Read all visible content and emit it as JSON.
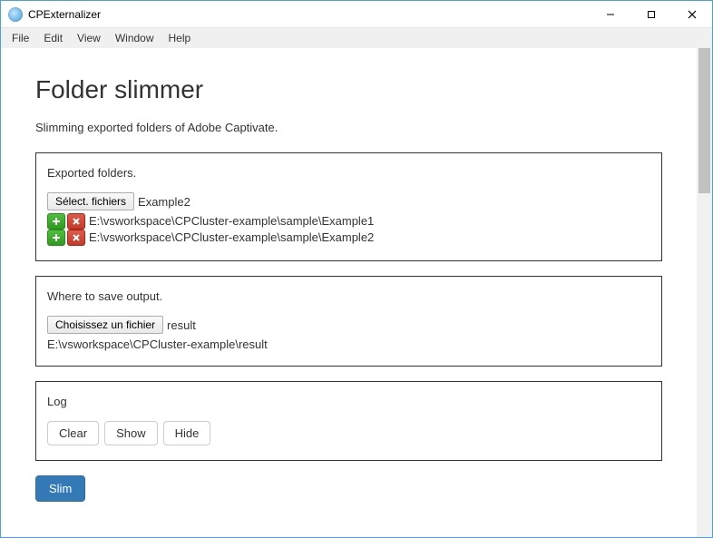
{
  "window": {
    "title": "CPExternalizer",
    "controls": {
      "min": "–",
      "max": "▢",
      "close": "✕"
    }
  },
  "menu": {
    "file": "File",
    "edit": "Edit",
    "view": "View",
    "window": "Window",
    "help": "Help"
  },
  "page": {
    "heading": "Folder slimmer",
    "subtitle": "Slimming exported folders of Adobe Captivate."
  },
  "exported": {
    "label": "Exported folders.",
    "select_btn": "Sélect. fichiers",
    "selected_name": "Example2",
    "items": [
      "E:\\vsworkspace\\CPCluster-example\\sample\\Example1",
      "E:\\vsworkspace\\CPCluster-example\\sample\\Example2"
    ]
  },
  "output": {
    "label": "Where to save output.",
    "choose_btn": "Choisissez un fichier",
    "chosen_name": "result",
    "path": "E:\\vsworkspace\\CPCluster-example\\result"
  },
  "log": {
    "label": "Log",
    "clear": "Clear",
    "show": "Show",
    "hide": "Hide"
  },
  "actions": {
    "slim": "Slim"
  }
}
